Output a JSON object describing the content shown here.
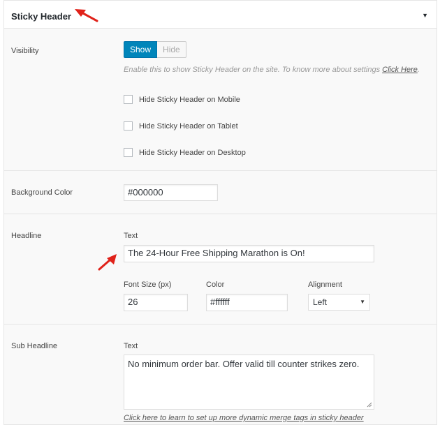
{
  "panel": {
    "title": "Sticky Header",
    "toggle_icon": "triangle-down-icon"
  },
  "visibility": {
    "label": "Visibility",
    "show_label": "Show",
    "hide_label": "Hide",
    "selected": "Show",
    "description": "Enable this to show Sticky Header on the site. To know more about settings ",
    "description_link": "Click Here",
    "description_end": ".",
    "checkboxes": [
      {
        "label": "Hide Sticky Header on Mobile",
        "checked": false
      },
      {
        "label": "Hide Sticky Header on Tablet",
        "checked": false
      },
      {
        "label": "Hide Sticky Header on Desktop",
        "checked": false
      }
    ]
  },
  "background": {
    "label": "Background Color",
    "value": "#000000"
  },
  "headline": {
    "label": "Headline",
    "text_label": "Text",
    "text_value": "The 24-Hour Free Shipping Marathon is On!",
    "font_size_label": "Font Size (px)",
    "font_size_value": "26",
    "color_label": "Color",
    "color_value": "#ffffff",
    "alignment_label": "Alignment",
    "alignment_value": "Left"
  },
  "sub_headline": {
    "label": "Sub Headline",
    "text_label": "Text",
    "text_value": "No minimum order bar. Offer valid till counter strikes zero.",
    "merge_link": "Click here to learn to set up more dynamic merge tags in sticky header"
  },
  "colors": {
    "accent": "#0085ba",
    "annotation_arrow": "#e0221a"
  }
}
